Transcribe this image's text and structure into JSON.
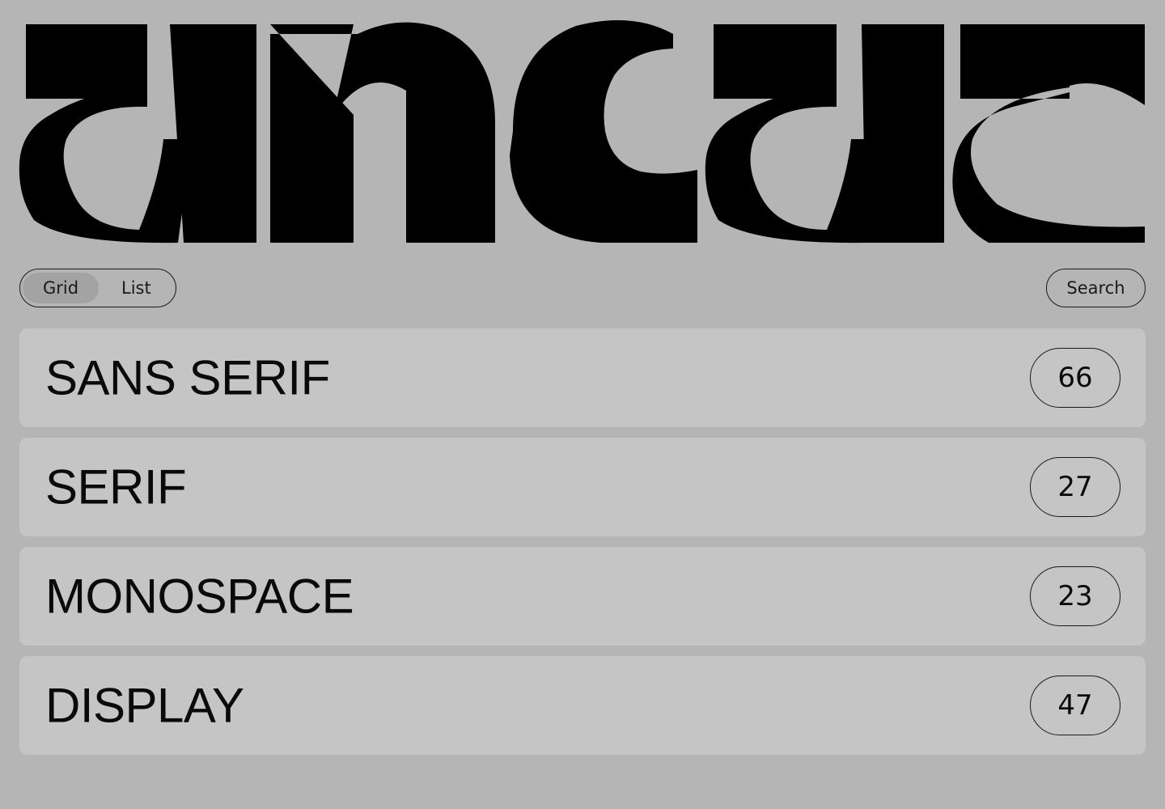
{
  "brand": {
    "logo_text": "ancat",
    "logo_color": "#000000"
  },
  "colors": {
    "background": "#b5b5b5",
    "row_background": "#c5c5c5",
    "toggle_active": "#a3a3a3",
    "text": "#0a0a0a"
  },
  "toolbar": {
    "view_toggle": {
      "grid_label": "Grid",
      "list_label": "List",
      "selected": "Grid"
    },
    "search_label": "Search"
  },
  "categories": [
    {
      "name": "SANS SERIF",
      "count": "66"
    },
    {
      "name": "SERIF",
      "count": "27"
    },
    {
      "name": "MONOSPACE",
      "count": "23"
    },
    {
      "name": "DISPLAY",
      "count": "47"
    }
  ]
}
